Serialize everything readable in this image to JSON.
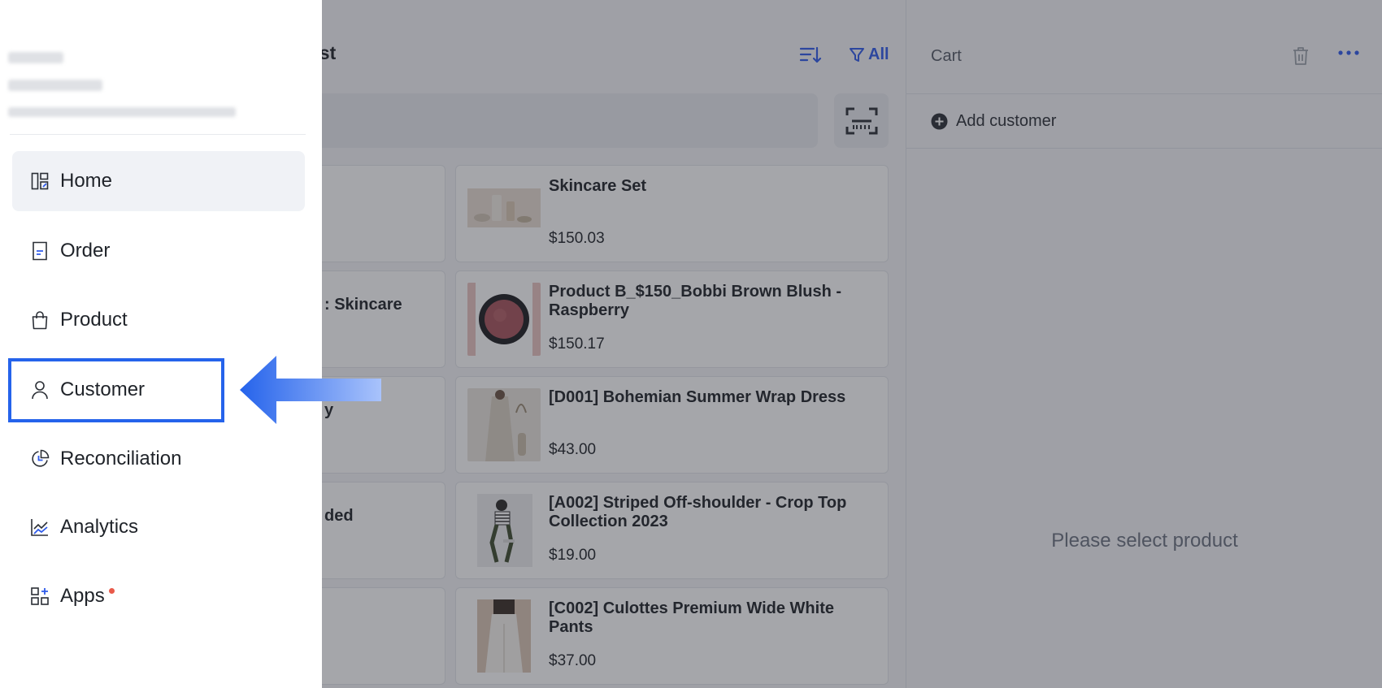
{
  "product_list": {
    "title_partial": "list",
    "filter_label": "All",
    "left_cards_partial": [
      "",
      ": Skincare",
      "y",
      "ded",
      ""
    ],
    "products": [
      {
        "name": "Skincare Set",
        "price": "$150.03",
        "thumb": "skincare"
      },
      {
        "name": "Product B_$150_Bobbi Brown Blush - Raspberry",
        "price": "$150.17",
        "thumb": "blush"
      },
      {
        "name": "[D001] Bohemian Summer Wrap Dress",
        "price": "$43.00",
        "thumb": "dress"
      },
      {
        "name": "[A002] Striped Off-shoulder - Crop Top Collection 2023",
        "price": "$19.00",
        "thumb": "croptop"
      },
      {
        "name": "[C002] Culottes Premium Wide White Pants",
        "price": "$37.00",
        "thumb": "pants"
      }
    ]
  },
  "cart": {
    "title": "Cart",
    "add_customer_label": "Add customer",
    "empty_message": "Please select product"
  },
  "sidebar": {
    "items": [
      {
        "label": "Home",
        "icon": "layout-icon",
        "active": true
      },
      {
        "label": "Order",
        "icon": "document-icon"
      },
      {
        "label": "Product",
        "icon": "shopping-bag-icon"
      },
      {
        "label": "Customer",
        "icon": "user-icon",
        "highlighted": true
      },
      {
        "label": "Reconciliation",
        "icon": "pie-chart-icon"
      },
      {
        "label": "Analytics",
        "icon": "trend-chart-icon"
      },
      {
        "label": "Apps",
        "icon": "apps-grid-icon",
        "badge_dot": true
      }
    ]
  },
  "colors": {
    "accent": "#2f5bea",
    "highlight": "#2563eb",
    "badge": "#e95a4a"
  }
}
